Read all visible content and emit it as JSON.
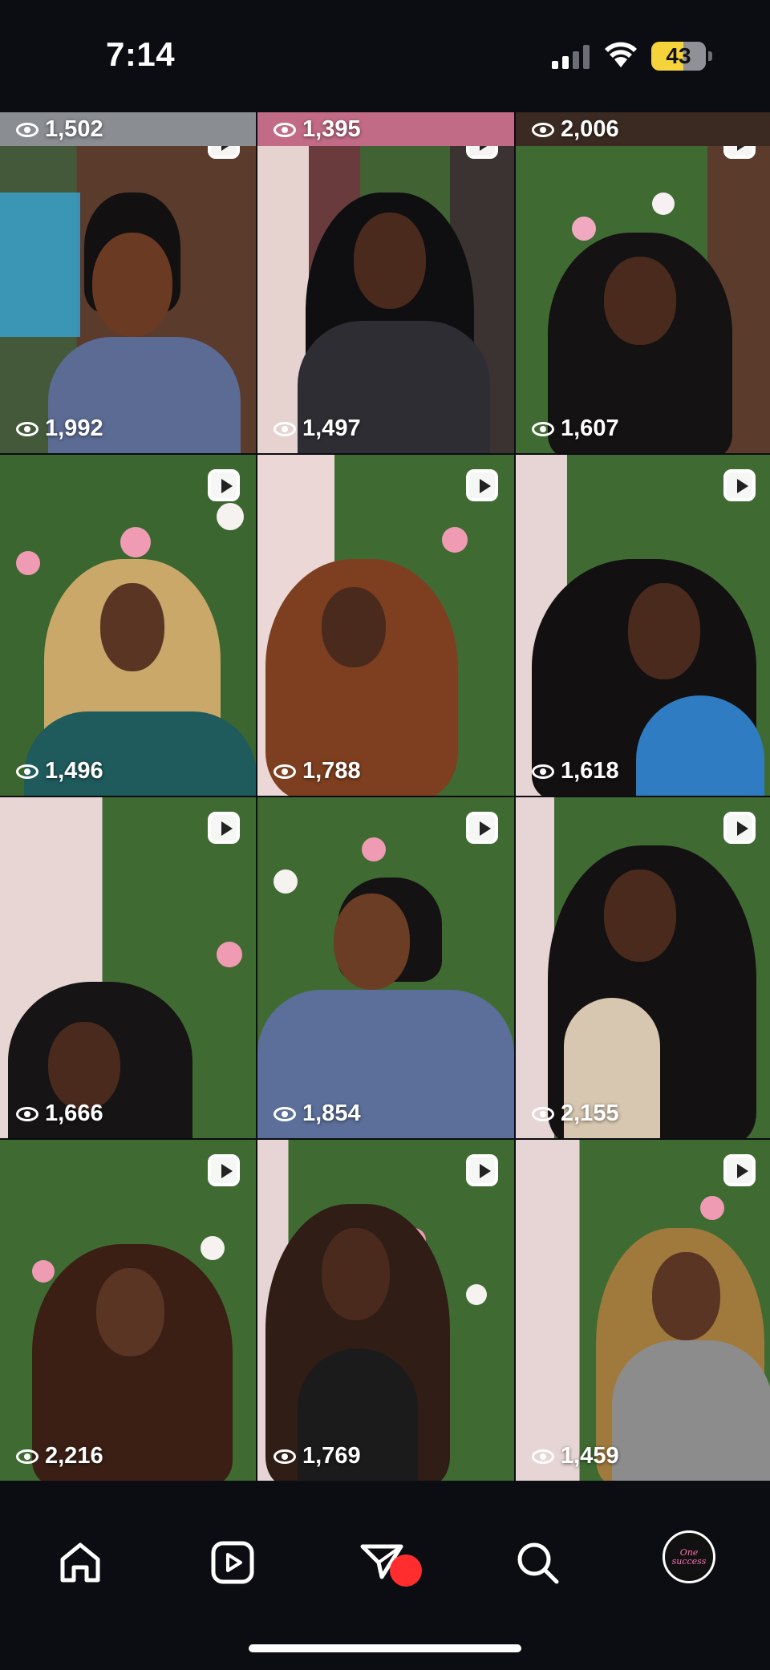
{
  "status_bar": {
    "time": "7:14",
    "battery": "43",
    "signal_bars_active": 2
  },
  "top_partial_row": [
    {
      "views": "1,502"
    },
    {
      "views": "1,395"
    },
    {
      "views": "2,006"
    }
  ],
  "grid": {
    "tiles": [
      {
        "views": "1,992",
        "icon": "reels-icon"
      },
      {
        "views": "1,497",
        "icon": "reels-icon"
      },
      {
        "views": "1,607",
        "icon": "reels-icon"
      },
      {
        "views": "1,496",
        "icon": "reels-icon"
      },
      {
        "views": "1,788",
        "icon": "reels-icon"
      },
      {
        "views": "1,618",
        "icon": "reels-icon"
      },
      {
        "views": "1,666",
        "icon": "reels-icon"
      },
      {
        "views": "1,854",
        "icon": "reels-icon"
      },
      {
        "views": "2,155",
        "icon": "reels-icon"
      },
      {
        "views": "2,216",
        "icon": "reels-icon"
      },
      {
        "views": "1,769",
        "icon": "reels-icon"
      },
      {
        "views": "1,459",
        "icon": "reels-icon"
      }
    ]
  },
  "bottom_nav": {
    "items": [
      "home-icon",
      "reels-icon",
      "direct-message-icon",
      "search-icon",
      "profile-avatar"
    ],
    "avatar_text": "One success",
    "notification_color": "#ff2d2d"
  },
  "colors": {
    "background": "#0b0d12",
    "battery": "#f5d33b"
  }
}
